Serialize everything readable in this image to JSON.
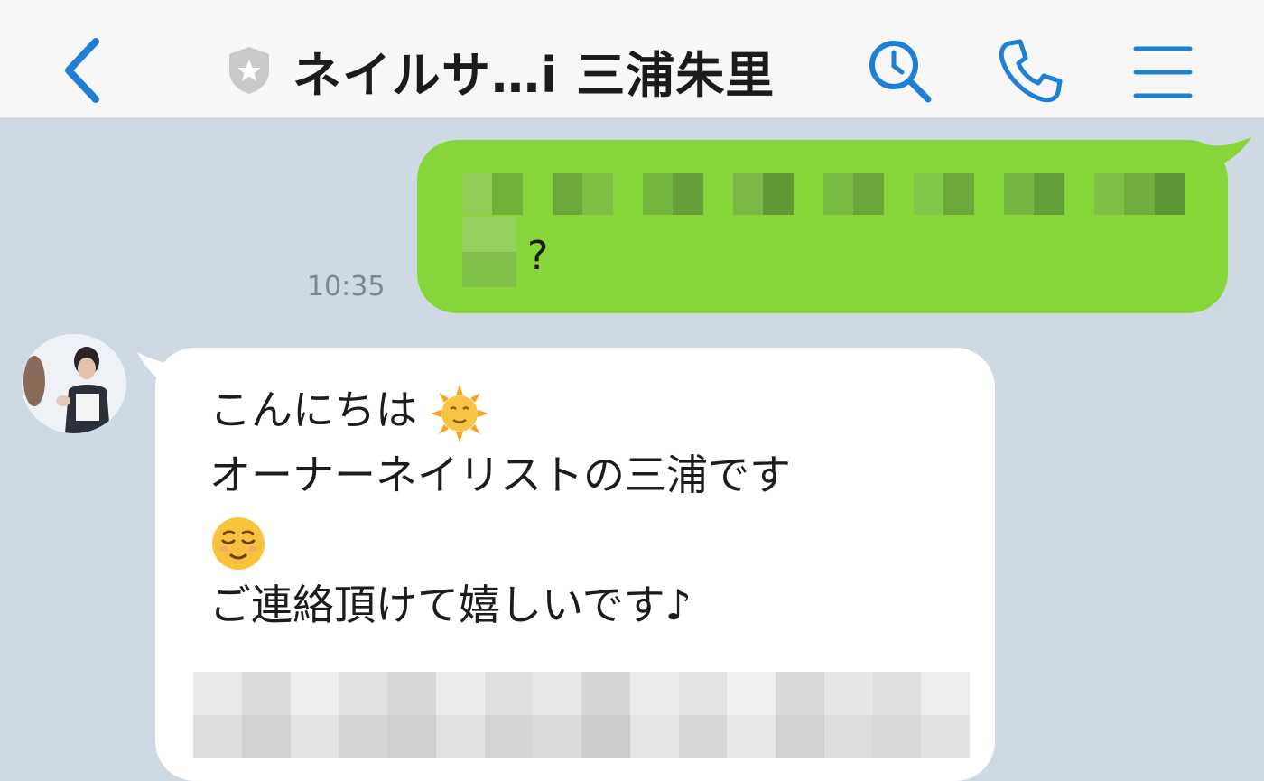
{
  "header": {
    "title": "ネイルサ…i 三浦朱里",
    "back_icon": "chevron-left-icon",
    "badge_icon": "shield-star-icon",
    "search_icon": "clock-search-icon",
    "call_icon": "phone-icon",
    "menu_icon": "hamburger-menu-icon",
    "accent_color": "#1e7fd6"
  },
  "messages": [
    {
      "direction": "sent",
      "visible_text": "?",
      "redacted": true,
      "time": "10:35",
      "bubble_color": "#86d63a"
    },
    {
      "direction": "received",
      "lines": [
        "こんにちは",
        "オーナーネイリストの三浦です",
        "",
        "ご連絡頂けて嬉しいです♪"
      ],
      "emoji": [
        "sun-with-face-emoji",
        "relieved-face-emoji"
      ],
      "redacted_block": true,
      "bubble_color": "#ffffff"
    }
  ],
  "colors": {
    "chat_background": "#cfd9e4",
    "header_background": "#f7f7f8",
    "time_text": "#7c8792"
  }
}
